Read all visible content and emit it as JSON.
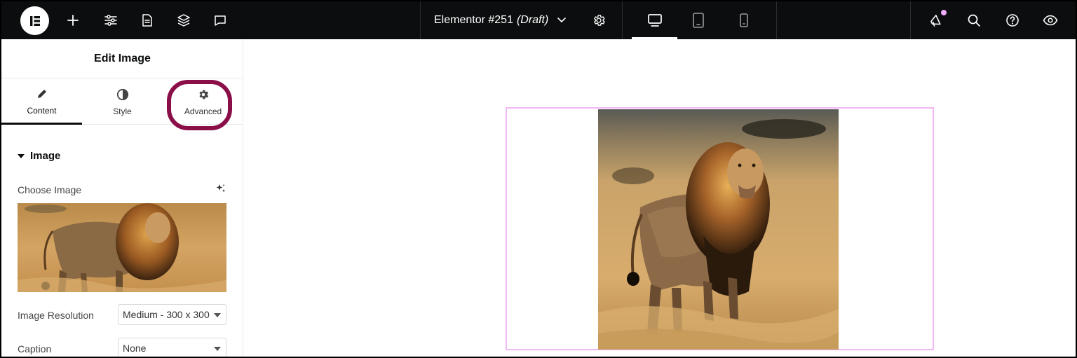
{
  "topbar": {
    "logo_icon": "elementor-logo-icon",
    "left_icons": [
      "add-icon",
      "site-settings-icon",
      "page-icon",
      "structure-layers-icon",
      "comments-icon"
    ],
    "document_name": "Elementor #251",
    "document_status": "(Draft)",
    "right_icons": [
      "whats-new-megaphone-icon",
      "search-icon",
      "help-icon",
      "preview-eye-icon"
    ],
    "notification_dot_color": "#f0abfc"
  },
  "panel": {
    "title": "Edit Image",
    "tabs": [
      {
        "label": "Content",
        "icon": "pencil-icon",
        "active": true
      },
      {
        "label": "Style",
        "icon": "contrast-circle-icon",
        "active": false
      },
      {
        "label": "Advanced",
        "icon": "gear-icon",
        "active": false
      }
    ],
    "highlight_color": "#8a0e47",
    "section": {
      "title": "Image",
      "choose_image_label": "Choose Image",
      "image_resolution_label": "Image Resolution",
      "image_resolution_value": "Medium - 300 x 300",
      "caption_label": "Caption",
      "caption_value": "None"
    }
  },
  "canvas": {
    "selection_outline_color": "#f0b8f5",
    "image_subject": "lion-in-savanna"
  }
}
